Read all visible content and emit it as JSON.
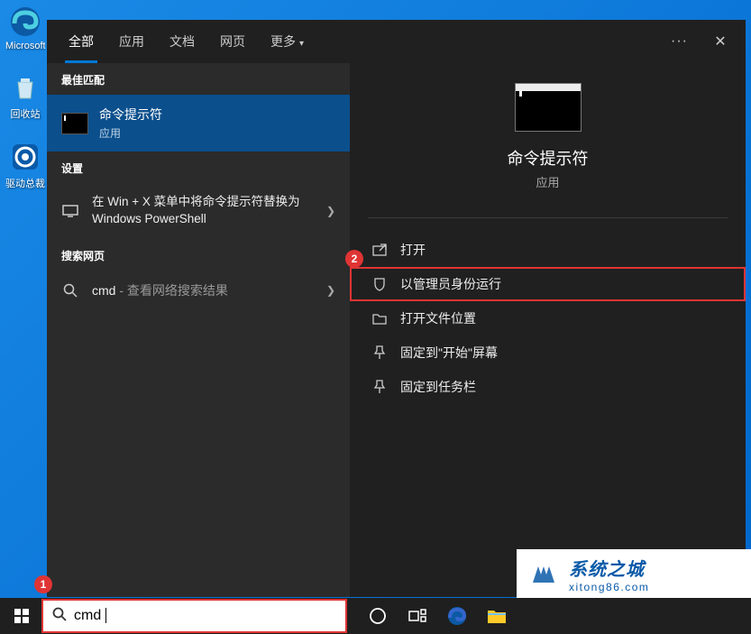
{
  "desktop": {
    "icons": [
      {
        "label": "Microsoft Edge",
        "type": "edge"
      },
      {
        "label": "回收站",
        "type": "recycle"
      },
      {
        "label": "驱动总裁",
        "type": "driver"
      }
    ]
  },
  "header": {
    "tabs": [
      {
        "label": "全部",
        "active": true
      },
      {
        "label": "应用",
        "active": false
      },
      {
        "label": "文档",
        "active": false
      },
      {
        "label": "网页",
        "active": false
      },
      {
        "label": "更多",
        "active": false,
        "dropdown": true
      }
    ]
  },
  "left": {
    "best_match_hdr": "最佳匹配",
    "best_match": {
      "title": "命令提示符",
      "sub": "应用"
    },
    "settings_hdr": "设置",
    "settings": [
      {
        "label": "在 Win + X 菜单中将命令提示符替换为 Windows PowerShell"
      }
    ],
    "web_hdr": "搜索网页",
    "web": [
      {
        "prefix": "cmd",
        "suffix": " - 查看网络搜索结果"
      }
    ]
  },
  "right": {
    "title": "命令提示符",
    "sub": "应用",
    "actions": [
      {
        "label": "打开",
        "icon": "open"
      },
      {
        "label": "以管理员身份运行",
        "icon": "admin",
        "highlight": true
      },
      {
        "label": "打开文件位置",
        "icon": "folder"
      },
      {
        "label": "固定到\"开始\"屏幕",
        "icon": "pin-start"
      },
      {
        "label": "固定到任务栏",
        "icon": "pin-taskbar"
      }
    ]
  },
  "badges": {
    "b1": "1",
    "b2": "2"
  },
  "search": {
    "text": "cmd"
  },
  "watermark": {
    "title": "系统之城",
    "url": "xitong86.com"
  }
}
